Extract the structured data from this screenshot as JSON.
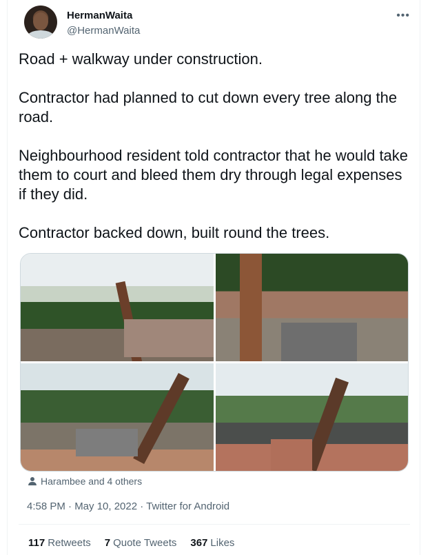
{
  "tweet": {
    "author": {
      "name": "HermanWaita",
      "handle": "@HermanWaita"
    },
    "more_icon": "more-horizontal-icon",
    "paragraphs": [
      "Road + walkway under construction.",
      "Contractor had planned to cut down every tree along the road.",
      "Neighbourhood resident told contractor that he would take them to court and bleed them dry through legal expenses if they did.",
      "Contractor backed down, built round the trees."
    ],
    "likers": "Harambee and 4 others",
    "timestamp": "4:58 PM · May 10, 2022",
    "source": "Twitter for Android",
    "stats": {
      "retweets_count": "117",
      "retweets_label": "Retweets",
      "quote_count": "7",
      "quote_label": "Quote Tweets",
      "likes_count": "367",
      "likes_label": "Likes"
    },
    "colors": {
      "text": "#0f1419",
      "secondary": "#536471",
      "border": "#eff3f4"
    }
  }
}
